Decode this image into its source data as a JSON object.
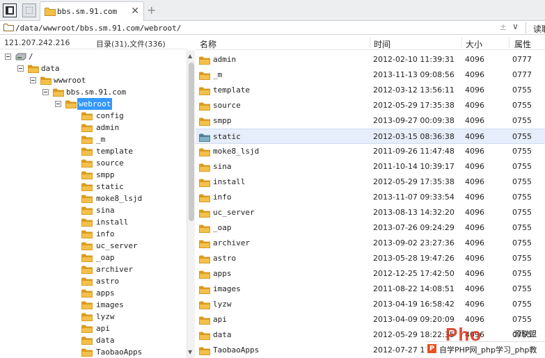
{
  "window": {
    "active_tab_title": "bbs.sm.91.com",
    "close_glyph": "✕",
    "new_tab_glyph": "+"
  },
  "address_bar": {
    "path": "/data/wwwroot/bbs.sm.91.com/webroot/",
    "sort_glyph": "±",
    "dropdown_glyph": "∨",
    "read_label": "读取"
  },
  "left_panel": {
    "server_ip": "121.207.242.216",
    "dir_summary": "目录(31),文件(336)"
  },
  "tree": {
    "path_nodes": [
      {
        "label": "/",
        "icon": "drive-icon"
      },
      {
        "label": "data",
        "icon": "folder-icon"
      },
      {
        "label": "wwwroot",
        "icon": "folder-icon"
      },
      {
        "label": "bbs.sm.91.com",
        "icon": "folder-icon"
      },
      {
        "label": "webroot",
        "icon": "folder-icon",
        "selected": true
      }
    ],
    "children": [
      "config",
      "admin",
      "_m",
      "template",
      "source",
      "smpp",
      "static",
      "moke8_lsjd",
      "sina",
      "install",
      "info",
      "uc_server",
      "_oap",
      "archiver",
      "astro",
      "apps",
      "images",
      "lyzw",
      "api",
      "data",
      "TaobaoApps"
    ]
  },
  "columns": {
    "name": "名称",
    "time": "时间",
    "size": "大小",
    "attr": "属性"
  },
  "files": [
    {
      "name": "admin",
      "time": "2012-02-10 11:39:31",
      "size": "4096",
      "attr": "0777"
    },
    {
      "name": "_m",
      "time": "2013-11-13 09:08:56",
      "size": "4096",
      "attr": "0777"
    },
    {
      "name": "template",
      "time": "2012-03-12 13:56:11",
      "size": "4096",
      "attr": "0755"
    },
    {
      "name": "source",
      "time": "2012-05-29 17:35:38",
      "size": "4096",
      "attr": "0755"
    },
    {
      "name": "smpp",
      "time": "2013-09-27 00:09:38",
      "size": "4096",
      "attr": "0755"
    },
    {
      "name": "static",
      "time": "2012-03-15 08:36:38",
      "size": "4096",
      "attr": "0755",
      "selected": true
    },
    {
      "name": "moke8_lsjd",
      "time": "2011-09-26 11:47:48",
      "size": "4096",
      "attr": "0755"
    },
    {
      "name": "sina",
      "time": "2011-10-14 10:39:17",
      "size": "4096",
      "attr": "0755"
    },
    {
      "name": "install",
      "time": "2012-05-29 17:35:38",
      "size": "4096",
      "attr": "0755"
    },
    {
      "name": "info",
      "time": "2013-11-07 09:33:54",
      "size": "4096",
      "attr": "0755"
    },
    {
      "name": "uc_server",
      "time": "2013-08-13 14:32:20",
      "size": "4096",
      "attr": "0755"
    },
    {
      "name": "_oap",
      "time": "2013-07-26 09:24:29",
      "size": "4096",
      "attr": "0755"
    },
    {
      "name": "archiver",
      "time": "2013-09-02 23:27:36",
      "size": "4096",
      "attr": "0755"
    },
    {
      "name": "astro",
      "time": "2013-05-28 19:47:26",
      "size": "4096",
      "attr": "0755"
    },
    {
      "name": "apps",
      "time": "2012-12-25 17:42:50",
      "size": "4096",
      "attr": "0755"
    },
    {
      "name": "images",
      "time": "2011-08-22 14:08:51",
      "size": "4096",
      "attr": "0755"
    },
    {
      "name": "lyzw",
      "time": "2013-04-19 16:58:42",
      "size": "4096",
      "attr": "0755"
    },
    {
      "name": "api",
      "time": "2013-04-09 09:20:09",
      "size": "4096",
      "attr": "0755"
    },
    {
      "name": "data",
      "time": "2012-05-29 18:22:35",
      "size": "4096",
      "attr": "0755"
    },
    {
      "name": "TaobaoApps",
      "time": "2012-07-27 17:",
      "size": "",
      "attr": ""
    }
  ],
  "watermark": {
    "logo": "Pho",
    "alliance": "源联盟",
    "badge": "P",
    "text": "自学PHP网_php学习_php教"
  },
  "colors": {
    "folder": "#f3c14b",
    "folder_dark": "#d99b1f",
    "selection": "#3399ff",
    "row_selected": "#e6eefb",
    "static_folder": "#7fb0c6"
  }
}
